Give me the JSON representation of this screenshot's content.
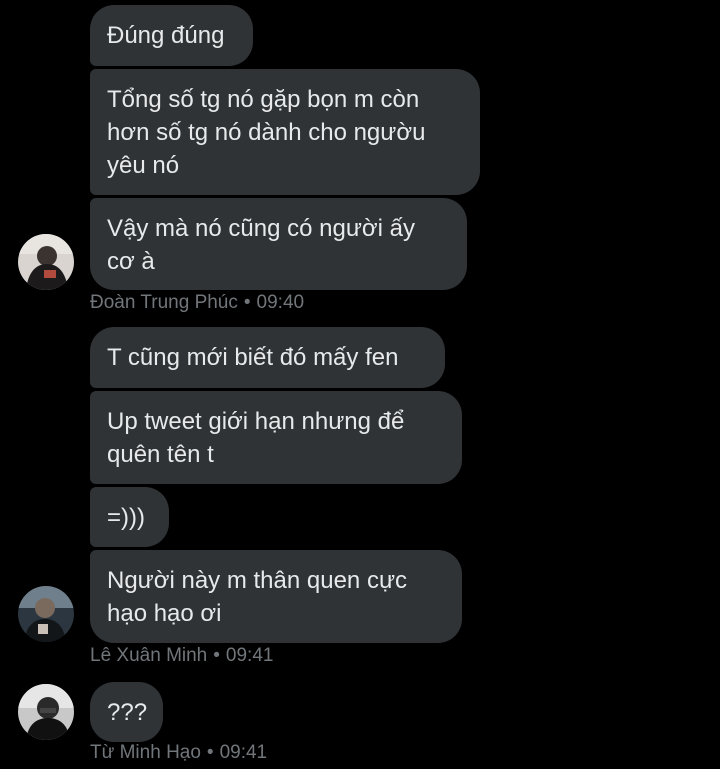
{
  "conversation": {
    "group1": {
      "messages": [
        "Đúng đúng",
        "Tổng số tg nó gặp bọn m còn\nhơn số tg nó dành cho ngườu\nyêu nó",
        "Vậy mà nó cũng có người ấy\ncơ à"
      ],
      "sender": "Đoàn Trung Phúc",
      "separator": "•",
      "time": "09:40"
    },
    "group2": {
      "messages": [
        "T cũng mới biết đó mấy fen",
        "Up tweet giới hạn nhưng để\nquên tên t",
        "=)))",
        "Người này m thân quen cực\nhạo hạo ơi"
      ],
      "sender": "Lê Xuân Minh",
      "separator": "•",
      "time": "09:41"
    },
    "group3": {
      "messages": [
        "???"
      ],
      "sender": "Từ Minh Hạo",
      "separator": "•",
      "time": "09:41"
    }
  },
  "colors": {
    "background": "#000000",
    "bubble": "#2f3336",
    "text": "#e7e9ea",
    "meta": "#71767b"
  }
}
